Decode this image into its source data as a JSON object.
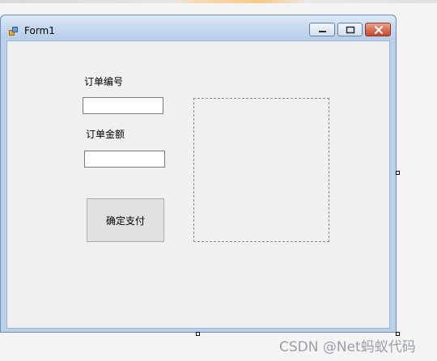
{
  "window": {
    "title": "Form1",
    "controls": {
      "minimize": "minimize",
      "maximize": "maximize",
      "close": "close"
    }
  },
  "form": {
    "order_number_label": "订单编号",
    "order_number_value": "",
    "order_amount_label": "订单金额",
    "order_amount_value": "",
    "confirm_button_label": "确定支付"
  },
  "icons": {
    "app": "form-app-icon",
    "minimize": "minimize-icon",
    "maximize": "maximize-icon",
    "close": "close-icon"
  },
  "watermark": "CSDN @Net蚂蚁代码",
  "colors": {
    "titlebar": "#c6d9ef",
    "client": "#f0f0f0",
    "close_button": "#c8452c",
    "button": "#e1e1e1"
  }
}
